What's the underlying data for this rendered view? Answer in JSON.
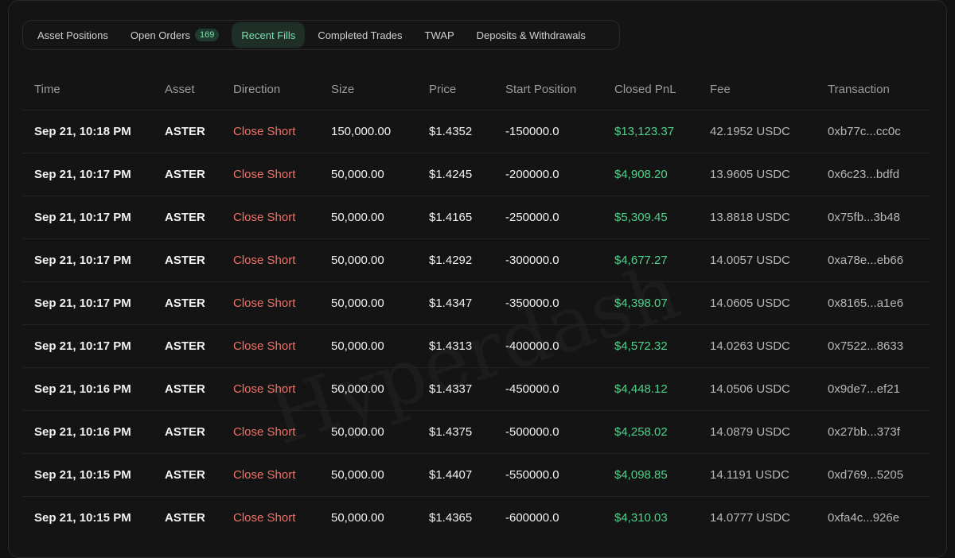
{
  "tabs": [
    {
      "label": "Asset Positions"
    },
    {
      "label": "Open Orders",
      "badge": "169"
    },
    {
      "label": "Recent Fills",
      "active": true
    },
    {
      "label": "Completed Trades"
    },
    {
      "label": "TWAP"
    },
    {
      "label": "Deposits & Withdrawals"
    }
  ],
  "columns": {
    "time": "Time",
    "asset": "Asset",
    "direction": "Direction",
    "size": "Size",
    "price": "Price",
    "start_position": "Start Position",
    "closed_pnl": "Closed PnL",
    "fee": "Fee",
    "transaction": "Transaction"
  },
  "rows": [
    {
      "time": "Sep 21, 10:18 PM",
      "asset": "ASTER",
      "direction": "Close Short",
      "size": "150,000.00",
      "price": "$1.4352",
      "start_position": "-150000.0",
      "closed_pnl": "$13,123.37",
      "fee": "42.1952 USDC",
      "transaction": "0xb77c...cc0c"
    },
    {
      "time": "Sep 21, 10:17 PM",
      "asset": "ASTER",
      "direction": "Close Short",
      "size": "50,000.00",
      "price": "$1.4245",
      "start_position": "-200000.0",
      "closed_pnl": "$4,908.20",
      "fee": "13.9605 USDC",
      "transaction": "0x6c23...bdfd"
    },
    {
      "time": "Sep 21, 10:17 PM",
      "asset": "ASTER",
      "direction": "Close Short",
      "size": "50,000.00",
      "price": "$1.4165",
      "start_position": "-250000.0",
      "closed_pnl": "$5,309.45",
      "fee": "13.8818 USDC",
      "transaction": "0x75fb...3b48"
    },
    {
      "time": "Sep 21, 10:17 PM",
      "asset": "ASTER",
      "direction": "Close Short",
      "size": "50,000.00",
      "price": "$1.4292",
      "start_position": "-300000.0",
      "closed_pnl": "$4,677.27",
      "fee": "14.0057 USDC",
      "transaction": "0xa78e...eb66"
    },
    {
      "time": "Sep 21, 10:17 PM",
      "asset": "ASTER",
      "direction": "Close Short",
      "size": "50,000.00",
      "price": "$1.4347",
      "start_position": "-350000.0",
      "closed_pnl": "$4,398.07",
      "fee": "14.0605 USDC",
      "transaction": "0x8165...a1e6"
    },
    {
      "time": "Sep 21, 10:17 PM",
      "asset": "ASTER",
      "direction": "Close Short",
      "size": "50,000.00",
      "price": "$1.4313",
      "start_position": "-400000.0",
      "closed_pnl": "$4,572.32",
      "fee": "14.0263 USDC",
      "transaction": "0x7522...8633"
    },
    {
      "time": "Sep 21, 10:16 PM",
      "asset": "ASTER",
      "direction": "Close Short",
      "size": "50,000.00",
      "price": "$1.4337",
      "start_position": "-450000.0",
      "closed_pnl": "$4,448.12",
      "fee": "14.0506 USDC",
      "transaction": "0x9de7...ef21"
    },
    {
      "time": "Sep 21, 10:16 PM",
      "asset": "ASTER",
      "direction": "Close Short",
      "size": "50,000.00",
      "price": "$1.4375",
      "start_position": "-500000.0",
      "closed_pnl": "$4,258.02",
      "fee": "14.0879 USDC",
      "transaction": "0x27bb...373f"
    },
    {
      "time": "Sep 21, 10:15 PM",
      "asset": "ASTER",
      "direction": "Close Short",
      "size": "50,000.00",
      "price": "$1.4407",
      "start_position": "-550000.0",
      "closed_pnl": "$4,098.85",
      "fee": "14.1191 USDC",
      "transaction": "0xd769...5205"
    },
    {
      "time": "Sep 21, 10:15 PM",
      "asset": "ASTER",
      "direction": "Close Short",
      "size": "50,000.00",
      "price": "$1.4365",
      "start_position": "-600000.0",
      "closed_pnl": "$4,310.03",
      "fee": "14.0777 USDC",
      "transaction": "0xfa4c...926e"
    }
  ],
  "watermark": "Hyperdash",
  "colors": {
    "background": "#121212",
    "accent_green": "#4fd18b",
    "direction_red": "#f07167",
    "active_tab_bg": "#1f2f28"
  }
}
